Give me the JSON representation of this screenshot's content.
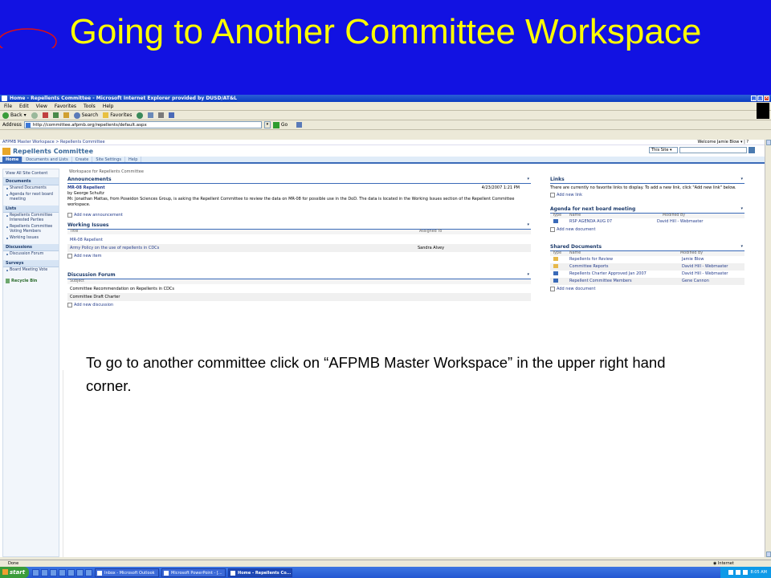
{
  "slide": {
    "title": "Going to Another Committee Workspace",
    "caption": "To go to another committee click on “AFPMB Master Workspace” in the upper right hand corner."
  },
  "browser": {
    "window_title": "Home - Repellents Committee - Microsoft Internet Explorer provided by DUSD/AT&L",
    "menu": [
      "File",
      "Edit",
      "View",
      "Favorites",
      "Tools",
      "Help"
    ],
    "toolbar": {
      "back": "Back",
      "search": "Search",
      "favorites": "Favorites"
    },
    "address_label": "Address",
    "address": "http://committee.afpmb.org/repellents/default.aspx",
    "go_label": "Go",
    "status": "Done",
    "zone": "Internet"
  },
  "site": {
    "breadcrumb": "AFPMB Master Workspace > Repellents Committee",
    "welcome": "Welcome Jamie Blow ▾ | ?",
    "title": "Repellents Committee",
    "search_scope": "This Site",
    "tabs": [
      "Home",
      "Documents and Lists",
      "Create",
      "Site Settings",
      "Help"
    ],
    "workspace_title": "Workspace for Repellents Committee"
  },
  "nav": {
    "view_all": "View All Site Content",
    "sections": [
      {
        "title": "Documents",
        "items": [
          "Shared Documents",
          "Agenda for next board meeting"
        ]
      },
      {
        "title": "Lists",
        "items": [
          "Repellents Committee Interested Parties",
          "Repellents Committee Voting Members",
          "Working Issues"
        ]
      },
      {
        "title": "Discussions",
        "items": [
          "Discussion Forum"
        ]
      },
      {
        "title": "Surveys",
        "items": [
          "Board Meeting Vote"
        ]
      }
    ],
    "recycle": "Recycle Bin"
  },
  "announcements": {
    "title": "Announcements",
    "item_title": "MR-08 Repellent",
    "item_author": "by George Schultz",
    "item_date": "4/23/2007 1:21 PM",
    "item_body": "Mr. Jonathan Mattas, from Poseidon Sciences Group, is asking the Repellent Committee to review the data on MR-08 for possible use in the DoD.  The data is located in the Working Issues section of the Repellent Committee workspace.",
    "add": "Add new announcement"
  },
  "working_issues": {
    "title": "Working Issues",
    "col_title": "Title",
    "col_assigned": "Assigned To",
    "rows": [
      {
        "title": "MR-08 Repellent",
        "assigned": ""
      },
      {
        "title": "Army Policy on the use of repellents in CDCs",
        "assigned": "Sandra Alvey"
      }
    ],
    "add": "Add new item"
  },
  "discussion": {
    "title": "Discussion Forum",
    "col_subject": "Subject",
    "rows": [
      "Committee Recommendation on Repellents in CDCs",
      "Committee Draft Charter"
    ],
    "add": "Add new discussion"
  },
  "links": {
    "title": "Links",
    "empty": "There are currently no favorite links to display. To add a new link, click \"Add new link\" below.",
    "add": "Add new link"
  },
  "agenda": {
    "title": "Agenda for next board meeting",
    "col_type": "Type",
    "col_name": "Name",
    "col_modified": "Modified By",
    "rows": [
      {
        "name": "RSP AGENDA AUG 07",
        "modified": "David Hill - Webmaster"
      }
    ],
    "add": "Add new document"
  },
  "shared_docs": {
    "title": "Shared Documents",
    "col_type": "Type",
    "col_name": "Name",
    "col_modified": "Modified By",
    "rows": [
      {
        "type": "folder",
        "name": "Repellents for Review",
        "modified": "Jamie Blow"
      },
      {
        "type": "folder",
        "name": "Committee Reports",
        "modified": "David Hill - Webmaster"
      },
      {
        "type": "doc",
        "name": "Repellents Charter Approved Jan 2007",
        "modified": "David Hill - Webmaster"
      },
      {
        "type": "doc",
        "name": "Repellent Committee Members",
        "modified": "Gene Cannon"
      }
    ],
    "add": "Add new document"
  },
  "taskbar": {
    "start": "start",
    "tasks": [
      "Inbox - Microsoft Outlook",
      "Microsoft PowerPoint - [...",
      "Home - Repellents Co..."
    ],
    "clock": "8:05 AM"
  },
  "menu_glyph": "▾"
}
